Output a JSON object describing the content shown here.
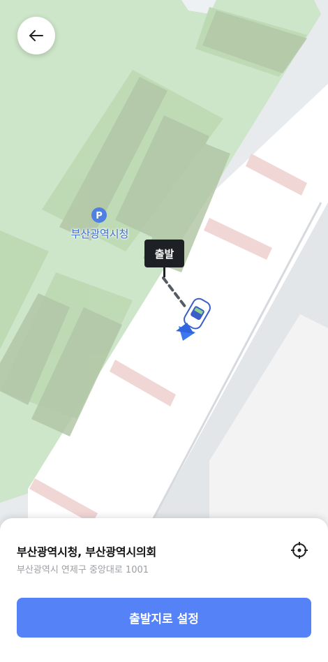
{
  "map": {
    "poi": {
      "label": "부산광역시청",
      "icon": "parking-icon"
    },
    "departure_tag": "출발"
  },
  "navigation": {
    "back_icon": "arrow-left-icon"
  },
  "sheet": {
    "place_name": "부산광역시청, 부산광역시의회",
    "address": "부산광역시 연제구 중앙대로 1001",
    "locate_icon": "crosshair-icon",
    "confirm_label": "출발지로 설정"
  },
  "colors": {
    "accent": "#5682f7",
    "park": "#c9e3c4",
    "poi_text": "#3d6ecb"
  }
}
